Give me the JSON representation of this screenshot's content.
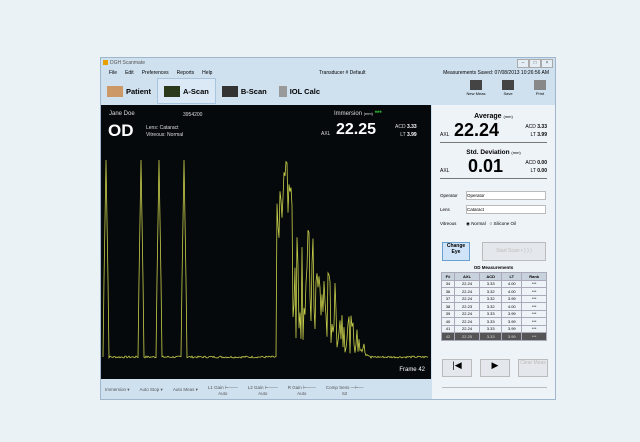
{
  "window": {
    "title": "DGH Scanmate"
  },
  "menu": [
    "File",
    "Edit",
    "Preferences",
    "Reports",
    "Help"
  ],
  "transducer": "Transducer # Default",
  "saved": "Measurements Saved: 07/08/2013  10:26:56 AM",
  "tabs": [
    "Patient",
    "A-Scan",
    "B-Scan",
    "IOL Calc"
  ],
  "tools": [
    "New Meas",
    "Save",
    "Print"
  ],
  "scan": {
    "patient": "Jane Doe",
    "id": "3954200",
    "eye": "OD",
    "lens_label": "Lens:",
    "lens": "Cataract",
    "vitreous_label": "Vitreous:",
    "vitreous": "Normal",
    "mode": "Immersion",
    "unit": "(mm)",
    "stars": "***",
    "axl_label": "AXL",
    "axl": "22.25",
    "acd_label": "ACD",
    "acd": "3.33",
    "lt_label": "LT",
    "lt": "3.99",
    "frame": "Frame 42"
  },
  "side": {
    "avg_title": "Average",
    "unit": "(mm)",
    "avg_axl": "22.24",
    "avg_acd": "3.33",
    "avg_lt": "3.99",
    "sd_title": "Std. Deviation",
    "sd_axl": "0.01",
    "sd_acd": "0.00",
    "sd_lt": "0.00",
    "axl": "AXL",
    "acd": "ACD",
    "lt": "LT",
    "operator_label": "Operator",
    "operator": "Operator",
    "lens_label": "Lens",
    "lens": "Cataract",
    "vitreous_label": "Vitreous",
    "normal": "Normal",
    "silicone": "Silicone Oil",
    "change_eye": "Change Eye",
    "start_scan": "Start Scan",
    "clear_meas": "Clear Meas",
    "table_title": "OD Measurements",
    "headers": [
      "F#",
      "AXL",
      "ACD",
      "LT",
      "Rank"
    ],
    "rows": [
      [
        "34",
        "22.24",
        "3.33",
        "4.00",
        "***"
      ],
      [
        "36",
        "22.24",
        "3.32",
        "4.00",
        "***"
      ],
      [
        "37",
        "22.24",
        "3.32",
        "3.99",
        "***"
      ],
      [
        "38",
        "22.23",
        "3.32",
        "4.00",
        "***"
      ],
      [
        "39",
        "22.24",
        "3.33",
        "3.99",
        "***"
      ],
      [
        "40",
        "22.24",
        "3.33",
        "3.99",
        "***"
      ],
      [
        "41",
        "22.24",
        "3.33",
        "3.99",
        "***"
      ],
      [
        "42",
        "22.25",
        "3.33",
        "3.99",
        "***"
      ]
    ]
  },
  "bottom": {
    "mode": "Immersion",
    "stop": "Auto Stop",
    "meas": "Auto Meas",
    "l1": "L1 Gain",
    "l1v": "Auto",
    "l2": "L2 Gain",
    "l2v": "Auto",
    "r": "R Gain",
    "rv": "Auto",
    "comp": "Comp Sens",
    "compv": "62"
  }
}
